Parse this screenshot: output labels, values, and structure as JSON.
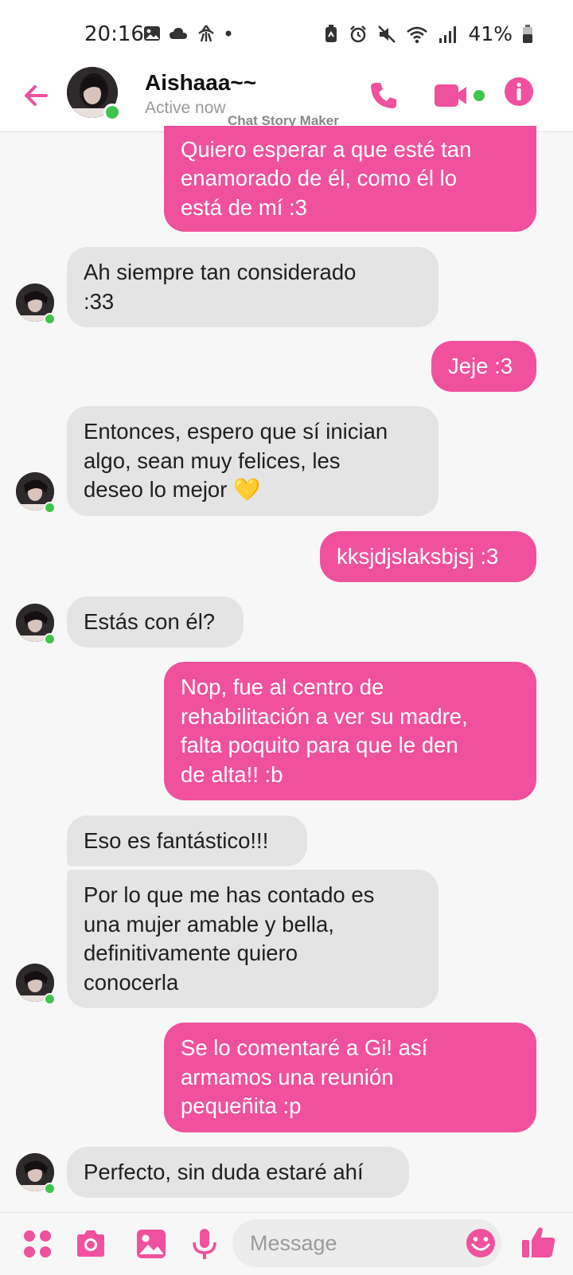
{
  "status_bar": {
    "time": "20:16",
    "battery": "41%"
  },
  "header": {
    "contact_name": "Aishaaa~~",
    "status": "Active now",
    "watermark": "Chat Story Maker"
  },
  "messages": [
    {
      "from": "me",
      "text": "Quiero esperar a que esté tan\nenamorado de él, como él lo\nestá de mí :3"
    },
    {
      "from": "them",
      "text": "Ah siempre tan considerado\n:33"
    },
    {
      "from": "me",
      "text": "Jeje :3"
    },
    {
      "from": "them",
      "text": "Entonces, espero que sí inician\nalgo, sean muy felices, les\ndeseo lo mejor 💛"
    },
    {
      "from": "me",
      "text": "kksjdjslaksbjsj :3"
    },
    {
      "from": "them",
      "text": "Estás con él?"
    },
    {
      "from": "me",
      "text": "Nop, fue al centro de\nrehabilitación a ver su madre,\nfalta poquito para que le den\nde alta!! :b"
    },
    {
      "from": "them",
      "text": "Eso es fantástico!!!"
    },
    {
      "from": "them",
      "text": "Por lo que me has contado es\nuna mujer amable y bella,\ndefinitivamente quiero\nconocerla"
    },
    {
      "from": "me",
      "text": "Se lo comentaré a Gi! así\narmamos una reunión\npequeñita :p"
    },
    {
      "from": "them",
      "text": "Perfecto, sin duda estaré ahí"
    }
  ],
  "composer": {
    "placeholder": "Message"
  },
  "colors": {
    "accent": "#f0519c",
    "incoming_bubble": "#e4e4e4",
    "online": "#3fc44c"
  },
  "icons": [
    "back-arrow-icon",
    "phone-icon",
    "video-camera-icon",
    "info-icon",
    "apps-icon",
    "camera-icon",
    "gallery-icon",
    "microphone-icon",
    "emoji-icon",
    "thumbs-up-icon"
  ]
}
